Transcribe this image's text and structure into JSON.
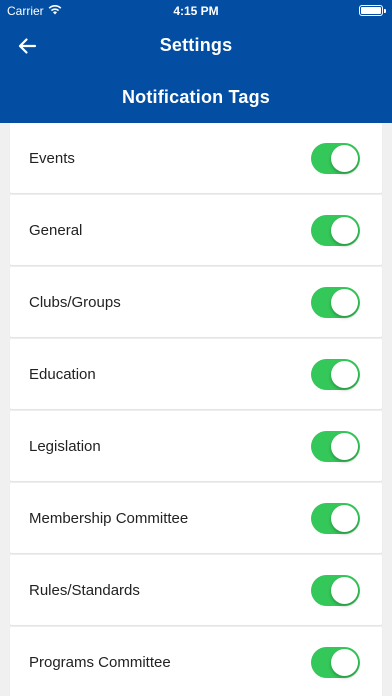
{
  "status_bar": {
    "carrier": "Carrier",
    "time": "4:15 PM"
  },
  "header": {
    "title": "Settings",
    "back_icon": "arrow-left-icon",
    "section_title": "Notification Tags",
    "color": "#034ea2"
  },
  "toggle_on_color": "#34c759",
  "tags": [
    {
      "label": "Events",
      "enabled": true
    },
    {
      "label": "General",
      "enabled": true
    },
    {
      "label": "Clubs/Groups",
      "enabled": true
    },
    {
      "label": "Education",
      "enabled": true
    },
    {
      "label": "Legislation",
      "enabled": true
    },
    {
      "label": "Membership Committee",
      "enabled": true
    },
    {
      "label": "Rules/Standards",
      "enabled": true
    },
    {
      "label": "Programs Committee",
      "enabled": true
    }
  ]
}
